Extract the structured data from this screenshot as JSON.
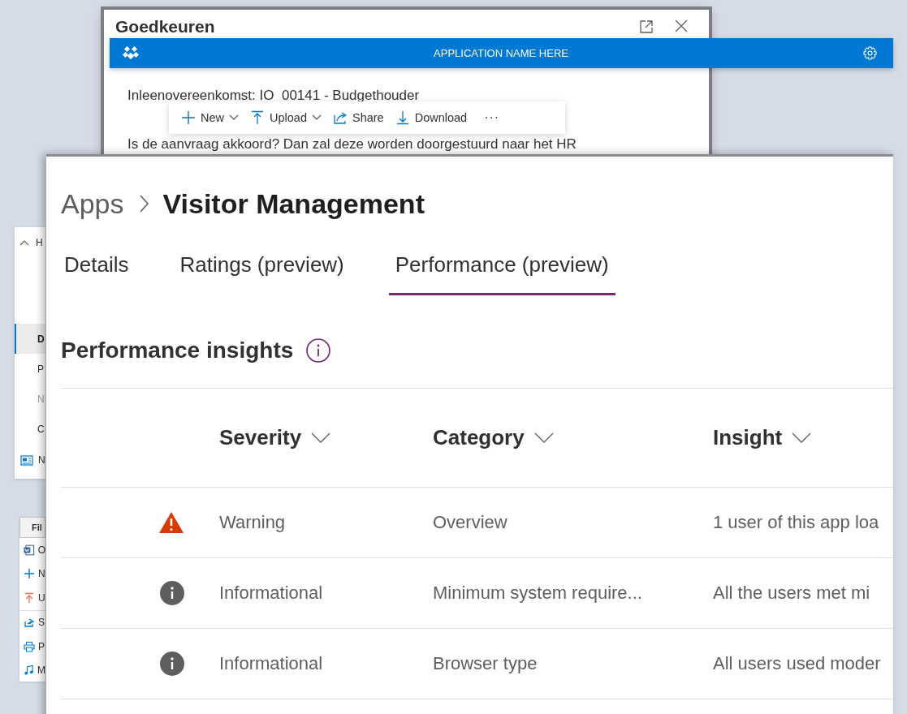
{
  "approval_dialog": {
    "title": "Goedkeuren",
    "subtitle": "Inleenovereenkomst: IO_00141 - Budgethouder",
    "message": "Is de aanvraag akkoord? Dan zal deze worden doorgestuurd naar het HR"
  },
  "app_bar": {
    "title": "APPLICATION NAME HERE"
  },
  "command_bar": [
    {
      "kind": "new",
      "label": "New",
      "dropdown": true
    },
    {
      "kind": "upload",
      "label": "Upload",
      "dropdown": true
    },
    {
      "kind": "share",
      "label": "Share",
      "dropdown": false
    },
    {
      "kind": "download",
      "label": "Download",
      "dropdown": false
    },
    {
      "kind": "more",
      "label": "···",
      "dropdown": false
    }
  ],
  "nav_panel": {
    "header": {
      "label": "H",
      "expanded": true
    },
    "items": [
      {
        "kind": "text",
        "label": "D",
        "selected": true,
        "disabled": false
      },
      {
        "kind": "text",
        "label": "P",
        "selected": false,
        "disabled": false
      },
      {
        "kind": "text",
        "label": "N",
        "selected": false,
        "disabled": true
      },
      {
        "kind": "text",
        "label": "C",
        "selected": false,
        "disabled": false
      },
      {
        "kind": "news",
        "label": "N",
        "selected": false,
        "disabled": false
      }
    ]
  },
  "file_menu": {
    "header": "Fil",
    "items": [
      {
        "kind": "word",
        "label": "O"
      },
      {
        "kind": "new",
        "label": "N"
      },
      {
        "kind": "upload",
        "label": "U"
      },
      {
        "kind": "share",
        "label": "S"
      },
      {
        "kind": "print",
        "label": "P"
      },
      {
        "kind": "music",
        "label": "M"
      }
    ]
  },
  "app_details": {
    "breadcrumb": [
      "Apps",
      "Visitor Management"
    ],
    "tabs": [
      {
        "label": "Details",
        "selected": false
      },
      {
        "label": "Ratings (preview)",
        "selected": false
      },
      {
        "label": "Performance (preview)",
        "selected": true
      }
    ],
    "section_title": "Performance insights",
    "table": {
      "columns": [
        "Severity",
        "Category",
        "Insight"
      ],
      "rows": [
        {
          "kind": "warning",
          "severity": "Warning",
          "category": "Overview",
          "insight": "1 user of this app loa"
        },
        {
          "kind": "info",
          "severity": "Informational",
          "category": "Minimum system require...",
          "insight": "All the users met mi"
        },
        {
          "kind": "info",
          "severity": "Informational",
          "category": "Browser type",
          "insight": "All users used moder"
        }
      ]
    }
  }
}
